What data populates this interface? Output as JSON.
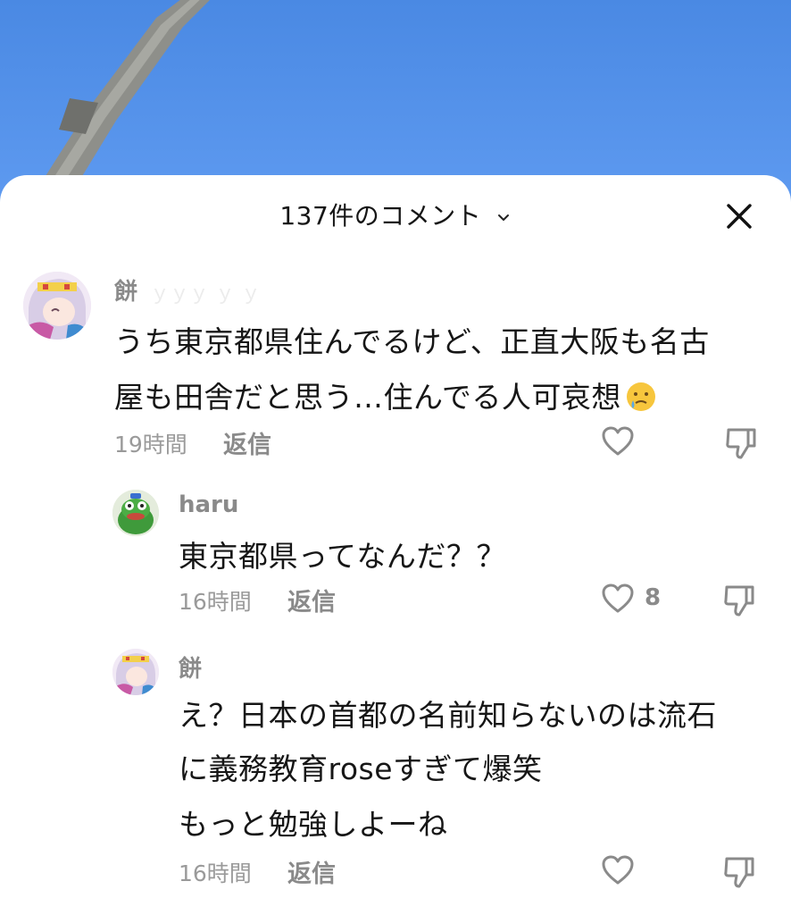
{
  "header": {
    "title": "137件のコメント"
  },
  "comments": [
    {
      "username": "餅",
      "lines": [
        "うち東京都県住んでるけど、正直大阪も名古",
        "屋も田舎だと思う…住んでる人可哀想"
      ],
      "emoji": "crying-face-emoji",
      "time": "19時間",
      "reply_label": "返信",
      "likes": ""
    },
    {
      "username": "haru",
      "lines": [
        "東京都県ってなんだ？？"
      ],
      "time": "16時間",
      "reply_label": "返信",
      "likes": "8"
    },
    {
      "username": "餅",
      "lines": [
        "え？日本の首都の名前知らないのは流石",
        "に義務教育roseすぎて爆笑",
        "もっと勉強しよーね"
      ],
      "time": "16時間",
      "reply_label": "返信",
      "likes": ""
    }
  ],
  "colors": {
    "sky": "#4f8ee6",
    "sheet": "#ffffff",
    "muted_text": "#8a8a8a",
    "body_text": "#161616"
  }
}
